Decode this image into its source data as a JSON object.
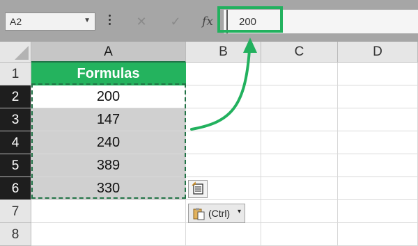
{
  "formula_bar": {
    "name_box": "A2",
    "cancel_icon": "✕",
    "enter_icon": "✓",
    "fx_label": "fx",
    "formula_value": "200"
  },
  "columns": [
    "A",
    "B",
    "C",
    "D"
  ],
  "rows": [
    "1",
    "2",
    "3",
    "4",
    "5",
    "6",
    "7",
    "8"
  ],
  "cells": {
    "A1": "Formulas",
    "A2": "200",
    "A3": "147",
    "A4": "240",
    "A5": "389",
    "A6": "330"
  },
  "paste_options": {
    "label": "(Ctrl)",
    "dropdown_icon": "▾"
  },
  "colors": {
    "accent": "#24b35e",
    "header_bg": "#e6e6e6",
    "selected_row_header": "#1e1e1e",
    "copied_fill": "#d0d0d0",
    "formula_bar_bg": "#a6a6a6"
  }
}
